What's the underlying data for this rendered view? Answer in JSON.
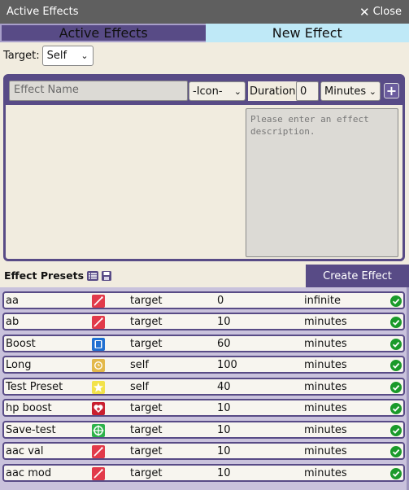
{
  "window": {
    "title": "Active Effects",
    "close_label": "Close"
  },
  "tabs": [
    {
      "label": "Active Effects"
    },
    {
      "label": "New Effect"
    }
  ],
  "target": {
    "label": "Target:",
    "value": "Self"
  },
  "form": {
    "name_placeholder": "Effect Name",
    "icon_value": "-Icon-",
    "duration_label": "Duration:",
    "duration_value": "0",
    "unit_value": "Minutes",
    "add_label": "+",
    "description_placeholder": "Please enter an effect description."
  },
  "presets": {
    "title": "Effect Presets",
    "create_label": "Create Effect",
    "rows": [
      {
        "name": "aa",
        "icon": "slash-icon",
        "target": "target",
        "duration": "0",
        "unit": "infinite"
      },
      {
        "name": "ab",
        "icon": "slash-icon",
        "target": "target",
        "duration": "10",
        "unit": "minutes"
      },
      {
        "name": "Boost",
        "icon": "book-icon",
        "target": "target",
        "duration": "60",
        "unit": "minutes"
      },
      {
        "name": "Long",
        "icon": "clock-icon",
        "target": "self",
        "duration": "100",
        "unit": "minutes"
      },
      {
        "name": "Test Preset",
        "icon": "star-icon",
        "target": "self",
        "duration": "40",
        "unit": "minutes"
      },
      {
        "name": "hp boost",
        "icon": "heart-icon",
        "target": "target",
        "duration": "10",
        "unit": "minutes"
      },
      {
        "name": "Save-test",
        "icon": "crosshair-icon",
        "target": "target",
        "duration": "10",
        "unit": "minutes"
      },
      {
        "name": "aac val",
        "icon": "slash-icon",
        "target": "target",
        "duration": "10",
        "unit": "minutes"
      },
      {
        "name": "aac mod",
        "icon": "slash-icon",
        "target": "target",
        "duration": "10",
        "unit": "minutes"
      }
    ]
  },
  "colors": {
    "accent": "#584b86",
    "tab_inactive": "#bfe9f7",
    "check": "#1a9a2a"
  }
}
